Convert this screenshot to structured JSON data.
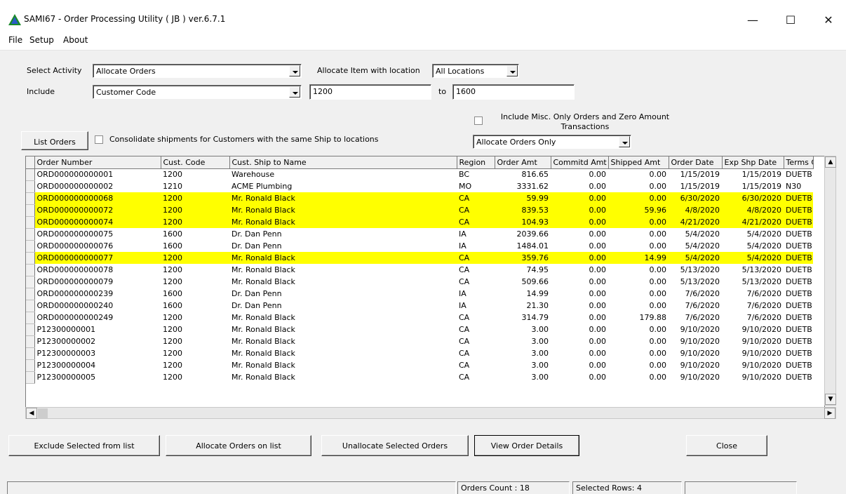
{
  "window": {
    "title": "SAMI67 - Order Processing Utility ( JB ) ver.6.7.1",
    "min_glyph": "—",
    "max_glyph": "☐",
    "close_glyph": "✕"
  },
  "menu": [
    "File",
    "Setup",
    "About"
  ],
  "filters": {
    "activity_label": "Select Activity",
    "activity_value": "Allocate Orders",
    "location_label": "Allocate Item with location",
    "location_value": "All Locations",
    "include_label": "Include",
    "include_value": "Customer Code",
    "range_from": "1200",
    "range_to_label": "to",
    "range_to": "1600",
    "misc_label": "Include Misc. Only Orders and Zero Amount Transactions",
    "misc_checked": false,
    "consolidate_label": "Consolidate shipments for Customers with the same Ship to locations",
    "consolidate_checked": false,
    "list_orders_label": "List Orders",
    "scope_value": "Allocate Orders Only"
  },
  "table": {
    "columns": [
      "Order Number",
      "Cust. Code",
      "Cust. Ship to Name",
      "Region",
      "Order Amt",
      "Commitd Amt",
      "Shipped Amt",
      "Order Date",
      "Exp Shp Date",
      "Terms C"
    ],
    "rows": [
      {
        "cells": [
          "ORD000000000001",
          "1200",
          "Warehouse",
          "BC",
          "816.65",
          "0.00",
          "0.00",
          "1/15/2019",
          "1/15/2019",
          "DUETB"
        ],
        "highlight": false
      },
      {
        "cells": [
          "ORD000000000002",
          "1210",
          "ACME Plumbing",
          "MO",
          "3331.62",
          "0.00",
          "0.00",
          "1/15/2019",
          "1/15/2019",
          "N30"
        ],
        "highlight": false
      },
      {
        "cells": [
          "ORD000000000068",
          "1200",
          "Mr. Ronald Black",
          "CA",
          "59.99",
          "0.00",
          "0.00",
          "6/30/2020",
          "6/30/2020",
          "DUETB"
        ],
        "highlight": true
      },
      {
        "cells": [
          "ORD000000000072",
          "1200",
          "Mr. Ronald Black",
          "CA",
          "839.53",
          "0.00",
          "59.96",
          "4/8/2020",
          "4/8/2020",
          "DUETB"
        ],
        "highlight": true
      },
      {
        "cells": [
          "ORD000000000074",
          "1200",
          "Mr. Ronald Black",
          "CA",
          "104.93",
          "0.00",
          "0.00",
          "4/21/2020",
          "4/21/2020",
          "DUETB"
        ],
        "highlight": true
      },
      {
        "cells": [
          "ORD000000000075",
          "1600",
          "Dr. Dan Penn",
          "IA",
          "2039.66",
          "0.00",
          "0.00",
          "5/4/2020",
          "5/4/2020",
          "DUETB"
        ],
        "highlight": false
      },
      {
        "cells": [
          "ORD000000000076",
          "1600",
          "Dr. Dan Penn",
          "IA",
          "1484.01",
          "0.00",
          "0.00",
          "5/4/2020",
          "5/4/2020",
          "DUETB"
        ],
        "highlight": false
      },
      {
        "cells": [
          "ORD000000000077",
          "1200",
          "Mr. Ronald Black",
          "CA",
          "359.76",
          "0.00",
          "14.99",
          "5/4/2020",
          "5/4/2020",
          "DUETB"
        ],
        "highlight": true
      },
      {
        "cells": [
          "ORD000000000078",
          "1200",
          "Mr. Ronald Black",
          "CA",
          "74.95",
          "0.00",
          "0.00",
          "5/13/2020",
          "5/13/2020",
          "DUETB"
        ],
        "highlight": false
      },
      {
        "cells": [
          "ORD000000000079",
          "1200",
          "Mr. Ronald Black",
          "CA",
          "509.66",
          "0.00",
          "0.00",
          "5/13/2020",
          "5/13/2020",
          "DUETB"
        ],
        "highlight": false
      },
      {
        "cells": [
          "ORD000000000239",
          "1600",
          "Dr. Dan Penn",
          "IA",
          "14.99",
          "0.00",
          "0.00",
          "7/6/2020",
          "7/6/2020",
          "DUETB"
        ],
        "highlight": false
      },
      {
        "cells": [
          "ORD000000000240",
          "1600",
          "Dr. Dan Penn",
          "IA",
          "21.30",
          "0.00",
          "0.00",
          "7/6/2020",
          "7/6/2020",
          "DUETB"
        ],
        "highlight": false
      },
      {
        "cells": [
          "ORD000000000249",
          "1200",
          "Mr. Ronald Black",
          "CA",
          "314.79",
          "0.00",
          "179.88",
          "7/6/2020",
          "7/6/2020",
          "DUETB"
        ],
        "highlight": false
      },
      {
        "cells": [
          "P12300000001",
          "1200",
          "Mr. Ronald Black",
          "CA",
          "3.00",
          "0.00",
          "0.00",
          "9/10/2020",
          "9/10/2020",
          "DUETB"
        ],
        "highlight": false
      },
      {
        "cells": [
          "P12300000002",
          "1200",
          "Mr. Ronald Black",
          "CA",
          "3.00",
          "0.00",
          "0.00",
          "9/10/2020",
          "9/10/2020",
          "DUETB"
        ],
        "highlight": false
      },
      {
        "cells": [
          "P12300000003",
          "1200",
          "Mr. Ronald Black",
          "CA",
          "3.00",
          "0.00",
          "0.00",
          "9/10/2020",
          "9/10/2020",
          "DUETB"
        ],
        "highlight": false
      },
      {
        "cells": [
          "P12300000004",
          "1200",
          "Mr. Ronald Black",
          "CA",
          "3.00",
          "0.00",
          "0.00",
          "9/10/2020",
          "9/10/2020",
          "DUETB"
        ],
        "highlight": false
      },
      {
        "cells": [
          "P12300000005",
          "1200",
          "Mr. Ronald Black",
          "CA",
          "3.00",
          "0.00",
          "0.00",
          "9/10/2020",
          "9/10/2020",
          "DUETB"
        ],
        "highlight": false
      }
    ]
  },
  "actions": {
    "exclude": "Exclude Selected from list",
    "allocate": "Allocate Orders on list",
    "unallocate": "Unallocate Selected Orders",
    "view_details": "View Order Details",
    "close": "Close"
  },
  "status": {
    "orders_count": "Orders Count : 18",
    "selected_rows": "Selected Rows: 4"
  },
  "colors": {
    "highlight": "#ffff00",
    "window_bg": "#f0f0f0",
    "app_icon": "#1a8a2a"
  }
}
